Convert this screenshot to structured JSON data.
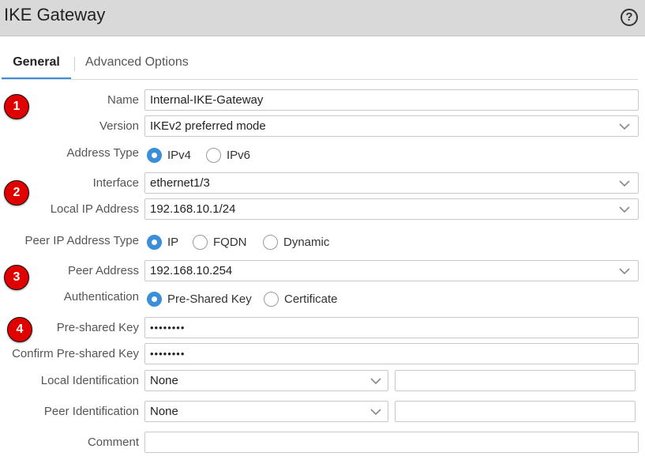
{
  "title": "IKE Gateway",
  "help_icon": "?",
  "tabs": [
    {
      "label": "General",
      "active": true
    },
    {
      "label": "Advanced Options",
      "active": false
    }
  ],
  "badges": [
    "1",
    "2",
    "3",
    "4"
  ],
  "form": {
    "name": {
      "label": "Name",
      "value": "Internal-IKE-Gateway"
    },
    "version": {
      "label": "Version",
      "value": "IKEv2 preferred mode"
    },
    "address_type": {
      "label": "Address Type",
      "options": [
        "IPv4",
        "IPv6"
      ],
      "selected": "IPv4"
    },
    "interface": {
      "label": "Interface",
      "value": "ethernet1/3"
    },
    "local_ip": {
      "label": "Local IP Address",
      "value": "192.168.10.1/24"
    },
    "peer_ip_type": {
      "label": "Peer IP Address Type",
      "options": [
        "IP",
        "FQDN",
        "Dynamic"
      ],
      "selected": "IP"
    },
    "peer_address": {
      "label": "Peer Address",
      "value": "192.168.10.254"
    },
    "authentication": {
      "label": "Authentication",
      "options": [
        "Pre-Shared Key",
        "Certificate"
      ],
      "selected": "Pre-Shared Key"
    },
    "psk": {
      "label": "Pre-shared Key",
      "value": "••••••••"
    },
    "confirm_psk": {
      "label": "Confirm Pre-shared Key",
      "value": "••••••••"
    },
    "local_identification": {
      "label": "Local Identification",
      "value": "None",
      "extra_value": ""
    },
    "peer_identification": {
      "label": "Peer Identification",
      "value": "None",
      "extra_value": ""
    },
    "comment": {
      "label": "Comment",
      "value": ""
    }
  },
  "colors": {
    "accent": "#3b8fd9",
    "badge": "#e00000",
    "titlebar": "#d9d9d9"
  },
  "icons": {
    "help": "question-circle-icon",
    "dropdown": "chevron-down-icon"
  }
}
